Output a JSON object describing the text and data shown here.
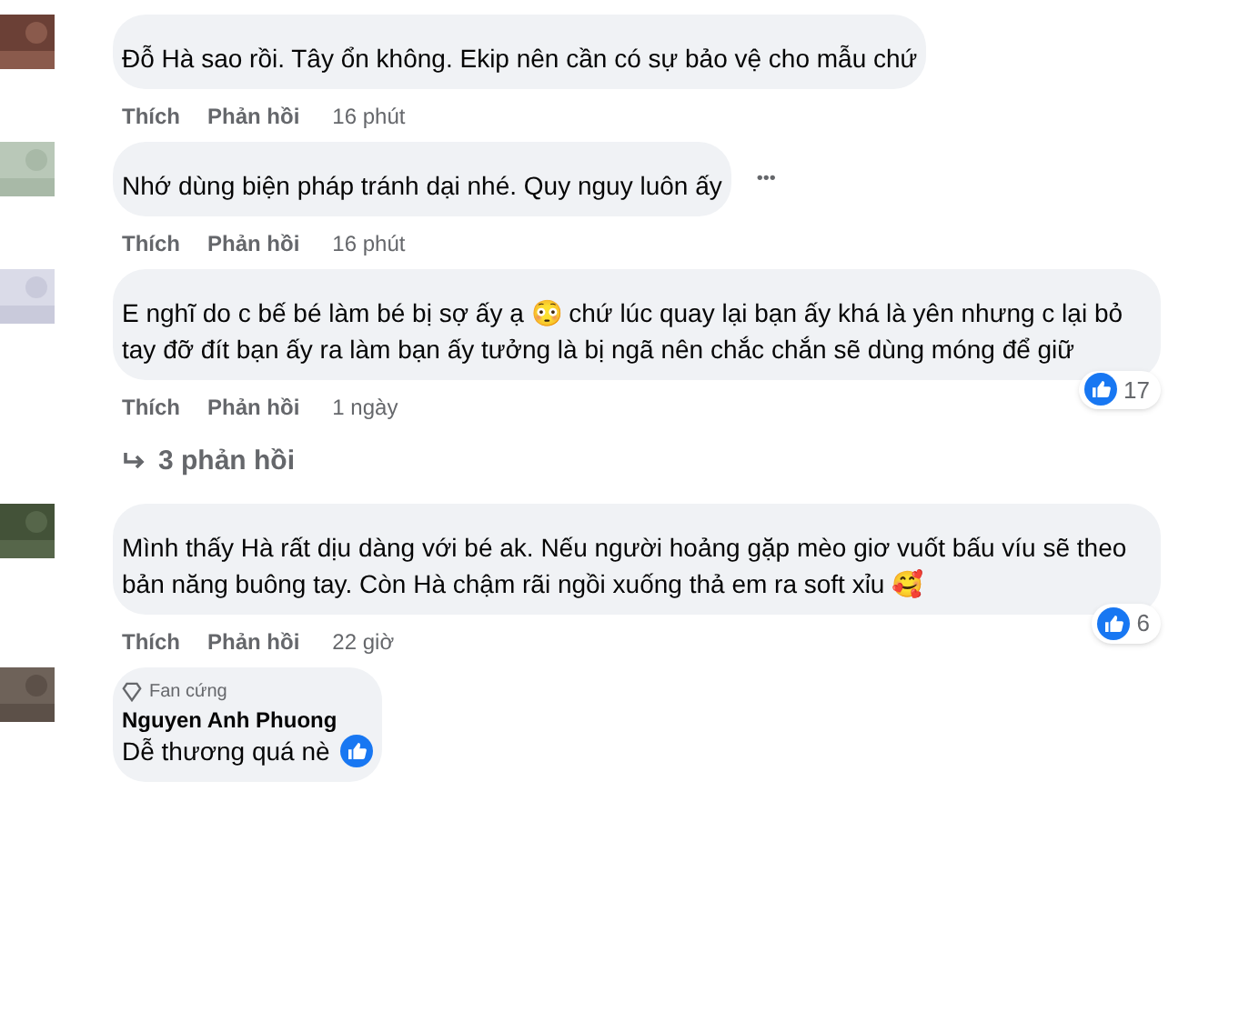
{
  "comments": [
    {
      "text": "Đỗ Hà sao rồi. Tây ổn không. Ekip nên cần có sự bảo vệ cho mẫu chứ",
      "actions": [
        "Thích",
        "Phản hồi"
      ],
      "time": "16 phút"
    },
    {
      "text": "Nhớ dùng biện pháp tránh dại nhé. Quy nguy luôn ấy",
      "actions": [
        "Thích",
        "Phản hồi"
      ],
      "time": "16 phút",
      "more": "•••"
    },
    {
      "text": "E nghĩ do c bế bé làm bé bị sợ ấy ạ 😳 chứ lúc quay lại bạn ấy khá là yên nhưng c lại bỏ tay đỡ đít bạn ấy ra làm bạn ấy tưởng là bị ngã nên chắc chắn sẽ dùng móng để giữ",
      "actions": [
        "Thích",
        "Phản hồi"
      ],
      "time": "1 ngày",
      "reactions": "17",
      "replies": "3 phản hồi"
    },
    {
      "text": "Mình thấy Hà rất dịu dàng với bé ak. Nếu người hoảng gặp mèo giơ vuốt bấu víu sẽ theo bản năng buông tay. Còn Hà chậm rãi ngồi xuống thả em ra soft xỉu 🥰",
      "actions": [
        "Thích",
        "Phản hồi"
      ],
      "time": "22 giờ",
      "reactions": "6"
    },
    {
      "badge": "Fan cứng",
      "author": "Nguyen Anh Phuong",
      "text": "Dễ thương quá nè",
      "inline_like": true
    }
  ]
}
